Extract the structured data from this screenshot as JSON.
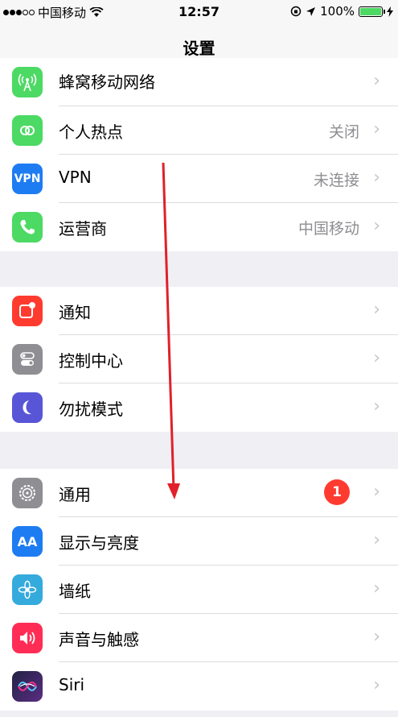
{
  "status_bar": {
    "carrier": "中国移动",
    "time": "12:57",
    "battery": "100%"
  },
  "nav": {
    "title": "设置"
  },
  "groups": [
    {
      "rows": [
        {
          "label": "蜂窝移动网络",
          "value": "",
          "icon": "antenna-icon",
          "color": "#4cd964"
        },
        {
          "label": "个人热点",
          "value": "关闭",
          "icon": "hotspot-icon",
          "color": "#4cd964"
        },
        {
          "label": "VPN",
          "value": "未连接",
          "icon": "vpn-icon",
          "color": "#1e7cf2",
          "icon_text": "VPN"
        },
        {
          "label": "运营商",
          "value": "中国移动",
          "icon": "phone-icon",
          "color": "#4cd964"
        }
      ]
    },
    {
      "rows": [
        {
          "label": "通知",
          "value": "",
          "icon": "notification-icon",
          "color": "#ff3b30"
        },
        {
          "label": "控制中心",
          "value": "",
          "icon": "control-center-icon",
          "color": "#8e8e93"
        },
        {
          "label": "勿扰模式",
          "value": "",
          "icon": "moon-icon",
          "color": "#5856d6"
        }
      ]
    },
    {
      "rows": [
        {
          "label": "通用",
          "value": "",
          "icon": "gear-icon",
          "color": "#8e8e93",
          "badge": "1"
        },
        {
          "label": "显示与亮度",
          "value": "",
          "icon": "display-icon",
          "color": "#1e7cf2",
          "icon_text": "AA"
        },
        {
          "label": "墙纸",
          "value": "",
          "icon": "wallpaper-icon",
          "color": "#35aadc"
        },
        {
          "label": "声音与触感",
          "value": "",
          "icon": "sound-icon",
          "color": "#ff2d55"
        },
        {
          "label": "Siri",
          "value": "",
          "icon": "siri-icon",
          "color": "#222244"
        }
      ]
    }
  ],
  "colors": {
    "annotation_arrow": "#e0202a",
    "background": "#efeff4",
    "badge": "#ff3b30"
  }
}
